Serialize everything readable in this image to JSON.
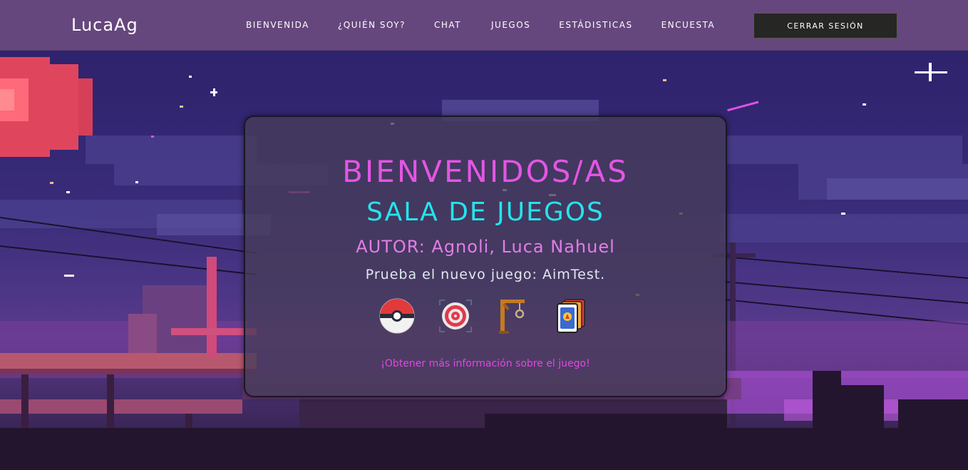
{
  "navbar": {
    "brand": "LucaAg",
    "links": [
      {
        "label": "BIENVENIDA"
      },
      {
        "label": "¿QUIÉN SOY?"
      },
      {
        "label": "CHAT"
      },
      {
        "label": "JUEGOS"
      },
      {
        "label": "ESTÁDISTICAS"
      },
      {
        "label": "ENCUESTA"
      }
    ],
    "logout_label": "CERRAR SESIÓN"
  },
  "card": {
    "title": "BIENVENIDOS/AS",
    "subtitle": "SALA DE JUEGOS",
    "author": "AUTOR: Agnoli, Luca Nahuel",
    "promo": "Prueba el nuevo juego: AimTest.",
    "games": [
      {
        "icon": "pokeball-icon"
      },
      {
        "icon": "target-icon"
      },
      {
        "icon": "gallows-icon"
      },
      {
        "icon": "cards-icon"
      }
    ],
    "more_info": "¡Obtener más información sobre el juego!"
  },
  "colors": {
    "navbar_bg": "#66477d",
    "title": "#e455e4",
    "subtitle": "#25e4ec",
    "author": "#e27ee6",
    "link": "#e048e0"
  }
}
